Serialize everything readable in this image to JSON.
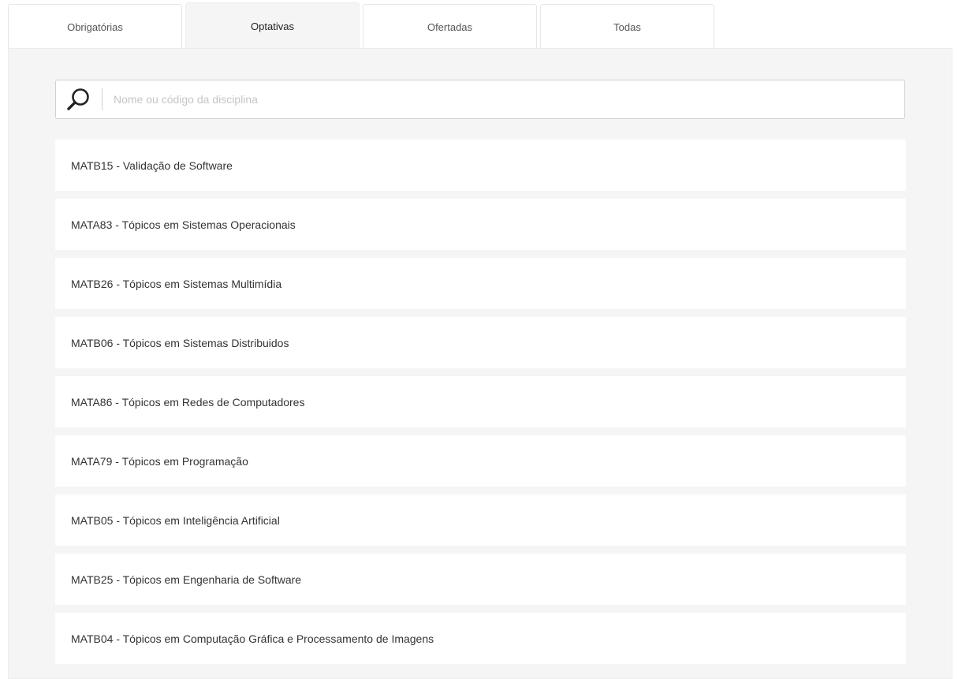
{
  "tabs": [
    {
      "label": "Obrigatórias",
      "active": false
    },
    {
      "label": "Optativas",
      "active": true
    },
    {
      "label": "Ofertadas",
      "active": false
    },
    {
      "label": "Todas",
      "active": false
    }
  ],
  "search": {
    "placeholder": "Nome ou código da disciplina",
    "value": "",
    "icon": "search-icon"
  },
  "courses": [
    {
      "label": "MATB15 - Validação de Software"
    },
    {
      "label": "MATA83 - Tópicos em Sistemas Operacionais"
    },
    {
      "label": "MATB26 - Tópicos em Sistemas Multimídia"
    },
    {
      "label": "MATB06 - Tópicos em Sistemas Distribuidos"
    },
    {
      "label": "MATA86 - Tópicos em Redes de Computadores"
    },
    {
      "label": "MATA79 - Tópicos em Programação"
    },
    {
      "label": "MATB05 - Tópicos em Inteligência Artificial"
    },
    {
      "label": "MATB25 - Tópicos em Engenharia de Software"
    },
    {
      "label": "MATB04 - Tópicos em Computação Gráfica e Processamento de Imagens"
    }
  ],
  "colors": {
    "panel_background": "#f5f5f5",
    "item_background": "#ffffff",
    "text": "#333333",
    "placeholder": "#c6c6c6"
  }
}
